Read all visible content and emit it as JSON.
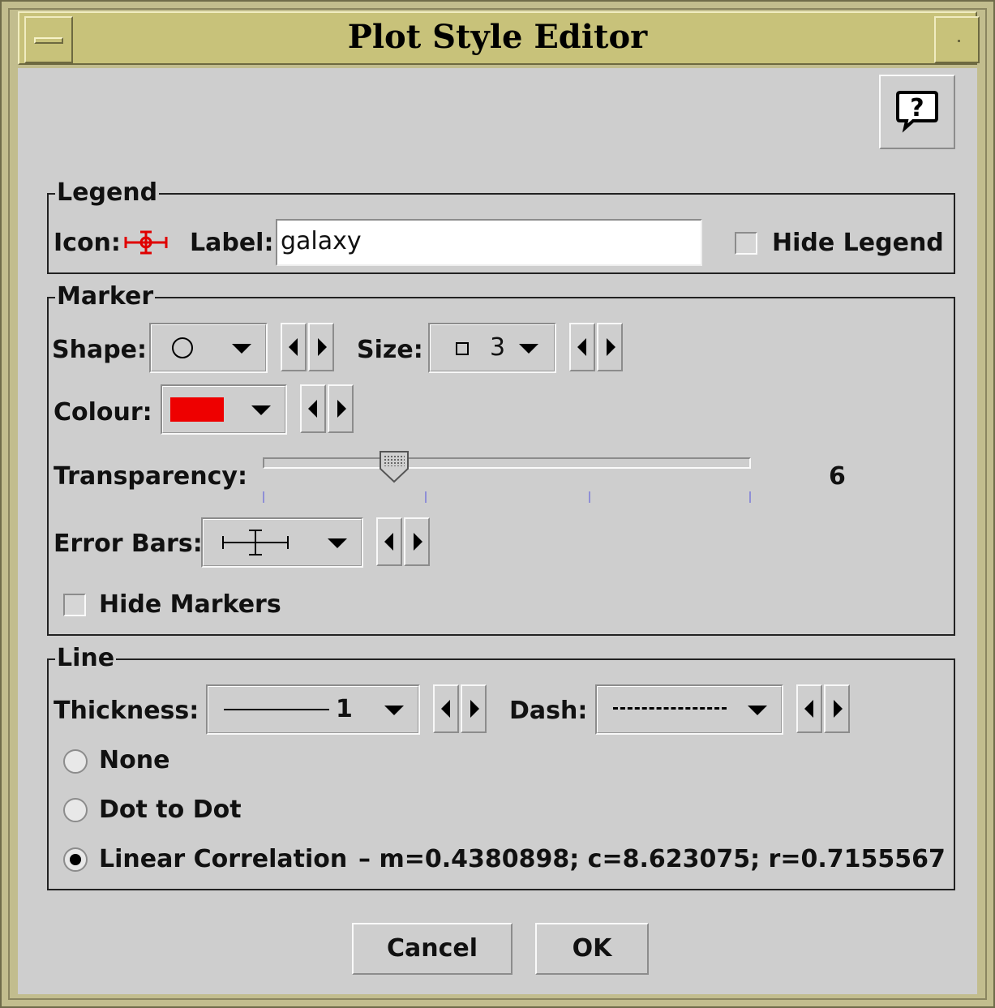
{
  "window": {
    "title": "Plot Style Editor"
  },
  "icons": {
    "menu": "window-menu-icon",
    "maximize": "maximize-icon",
    "help": "help-bubble-icon"
  },
  "legend": {
    "title": "Legend",
    "icon_label": "Icon:",
    "label_label": "Label:",
    "label_value": "galaxy",
    "hide_legend_label": "Hide Legend",
    "hide_legend_checked": false,
    "icon_color": "#e00000"
  },
  "marker": {
    "title": "Marker",
    "shape_label": "Shape:",
    "shape_value": "circle",
    "size_label": "Size:",
    "size_value": "3",
    "colour_label": "Colour:",
    "colour_value": "#ee0000",
    "transparency_label": "Transparency:",
    "transparency_value": "6",
    "transparency_fraction": 0.27,
    "error_bars_label": "Error Bars:",
    "error_bars_value": "x-y-capped",
    "hide_markers_label": "Hide Markers",
    "hide_markers_checked": false
  },
  "line": {
    "title": "Line",
    "thickness_label": "Thickness:",
    "thickness_value": "1",
    "dash_label": "Dash:",
    "dash_value": "dotted",
    "options": [
      {
        "label": "None",
        "selected": false
      },
      {
        "label": "Dot to Dot",
        "selected": false
      },
      {
        "label": "Linear Correlation",
        "selected": true
      }
    ],
    "correlation_stats": "– m=0.4380898; c=8.623075; r=0.7155567"
  },
  "buttons": {
    "cancel": "Cancel",
    "ok": "OK"
  }
}
